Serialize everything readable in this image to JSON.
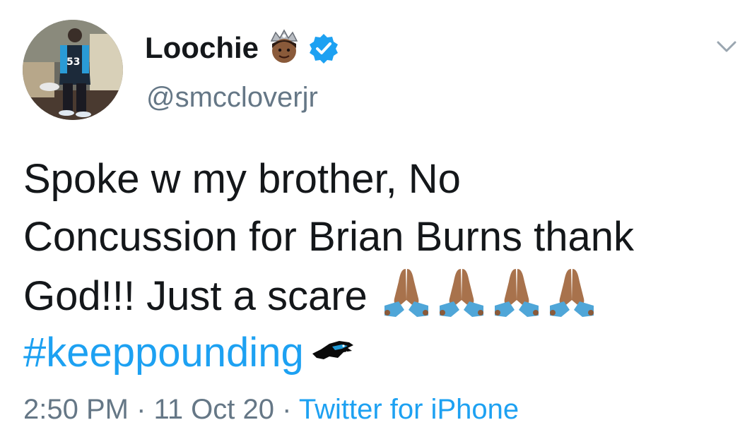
{
  "tweet": {
    "author": {
      "display_name": "Loochie",
      "handle": "@smccloverjr",
      "verified": true,
      "avatar_jersey_number": "53",
      "name_emoji": "prince-emoji"
    },
    "text_lines": [
      "Spoke w my brother, No",
      "Concussion for Brian Burns thank",
      "God!!! Just a scare"
    ],
    "prayer_emoji_count": 4,
    "hashtag": "#keeppounding",
    "hashtag_emoji": "panthers-logo",
    "time": "2:50 PM",
    "separator": "·",
    "date": "11 Oct 20",
    "source": "Twitter for iPhone"
  },
  "colors": {
    "text": "#14171a",
    "secondary": "#657786",
    "link": "#1da1f2",
    "background": "#ffffff"
  }
}
